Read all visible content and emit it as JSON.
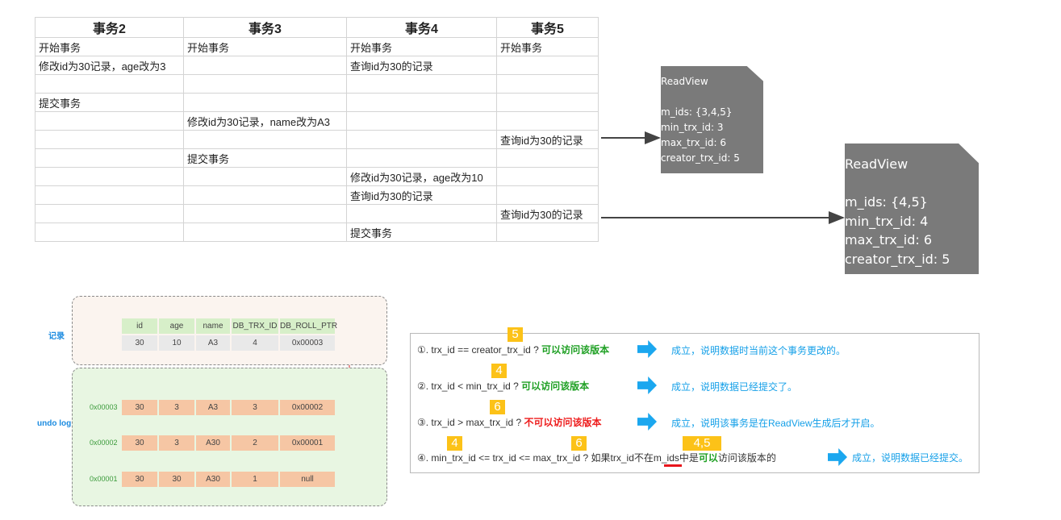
{
  "table": {
    "headers": [
      "事务2",
      "事务3",
      "事务4",
      "事务5"
    ],
    "rows": [
      [
        "开始事务",
        "开始事务",
        "开始事务",
        "开始事务"
      ],
      [
        "修改id为30记录，age改为3",
        "",
        "查询id为30的记录",
        ""
      ],
      [
        "",
        "",
        "",
        ""
      ],
      [
        "提交事务",
        "",
        "",
        ""
      ],
      [
        "",
        "修改id为30记录，name改为A3",
        "",
        ""
      ],
      [
        "",
        "",
        "",
        "查询id为30的记录"
      ],
      [
        "",
        "提交事务",
        "",
        ""
      ],
      [
        "",
        "",
        "修改id为30记录，age改为10",
        ""
      ],
      [
        "",
        "",
        "查询id为30的记录",
        ""
      ],
      [
        "",
        "",
        "",
        "查询id为30的记录"
      ],
      [
        "",
        "",
        "提交事务",
        ""
      ]
    ]
  },
  "readview_small": {
    "title": "ReadView",
    "m_ids": "m_ids: {3,4,5}",
    "min_trx_id": "min_trx_id: 3",
    "max_trx_id": "max_trx_id: 6",
    "creator_trx_id": "creator_trx_id: 5"
  },
  "readview_large": {
    "title": "ReadView",
    "m_ids": "m_ids: {4,5}",
    "min_trx_id": "min_trx_id: 4",
    "max_trx_id": "max_trx_id: 6",
    "creator_trx_id": "creator_trx_id: 5"
  },
  "record": {
    "label": "记录",
    "columns": [
      "id",
      "age",
      "name",
      "DB_TRX_ID",
      "DB_ROLL_PTR"
    ],
    "values": [
      "30",
      "10",
      "A3",
      "4",
      "0x00003"
    ]
  },
  "undo_log": {
    "label": "undo log",
    "entries": [
      {
        "addr": "0x00003",
        "values": [
          "30",
          "3",
          "A3",
          "3",
          "0x00002"
        ]
      },
      {
        "addr": "0x00002",
        "values": [
          "30",
          "3",
          "A30",
          "2",
          "0x00001"
        ]
      },
      {
        "addr": "0x00001",
        "values": [
          "30",
          "30",
          "A30",
          "1",
          "null"
        ]
      }
    ]
  },
  "rules": [
    {
      "badge": "5",
      "prefix": "①. trx_id  == creator_trx_id ? ",
      "verdict": "可以访问该版本",
      "note": "成立，说明数据时当前这个事务更改的。"
    },
    {
      "badge": "4",
      "prefix": "②. trx_id < min_trx_id ? ",
      "verdict": "可以访问该版本",
      "note": "成立，说明数据已经提交了。"
    },
    {
      "badge": "6",
      "prefix": "③. trx_id > max_trx_id ?  ",
      "verdict": "不可以访问该版本",
      "note": "成立，说明该事务是在ReadView生成后才开启。"
    },
    {
      "badges": [
        "4",
        "6",
        "4,5"
      ],
      "prefix": "④. min_trx_id <= trx_id <= max_trx_id ?  如果trx_id",
      "not_in": "不在",
      "middle": "m_ids中是",
      "can": "可以",
      "suffix": "访问该版本的",
      "note": "成立，说明数据已经提交。"
    }
  ],
  "colors": {
    "readview_bg": "#7a7a7a",
    "arrow_blue": "#1ba7ef",
    "badge_yellow": "#fcc218",
    "ok_green": "#1fa024",
    "no_red": "#ee1c1c",
    "note_blue": "#16a0e8",
    "undo_cell": "#f6c6a4",
    "header_cell": "#d7efc9"
  }
}
